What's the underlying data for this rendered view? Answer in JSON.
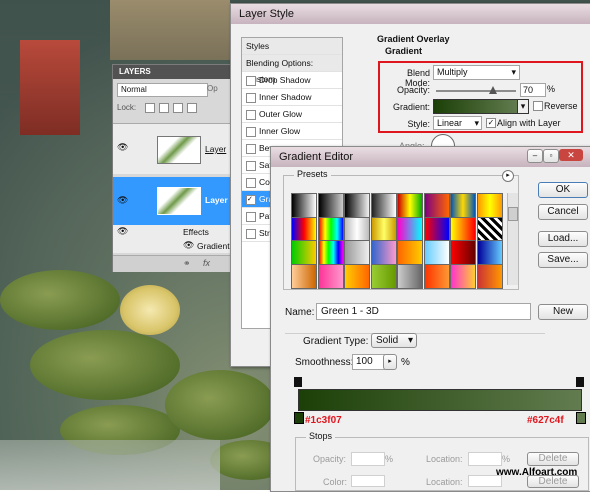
{
  "layers_panel": {
    "title": "LAYERS",
    "blend_mode": "Normal",
    "opacity_label": "Op",
    "lock_label": "Lock:",
    "layer1_name": "Layer",
    "layer2_name": "Layer",
    "effects_label": "Effects",
    "gradient_effect_label": "Gradient",
    "footer_fx": "fx"
  },
  "layer_style": {
    "title": "Layer Style",
    "styles_header": "Styles",
    "blending_options": "Blending Options: Custom",
    "items": [
      "Drop Shadow",
      "Inner Shadow",
      "Outer Glow",
      "Inner Glow",
      "Bev",
      "Sat",
      "Colo",
      "Gra",
      "Patt",
      "Stro"
    ],
    "active_index": 7,
    "section_title": "Gradient Overlay",
    "subsection_title": "Gradient",
    "blend_mode_label": "Blend Mode:",
    "blend_mode_value": "Multiply",
    "opacity_label": "Opacity:",
    "opacity_value": "70",
    "percent": "%",
    "gradient_label": "Gradient:",
    "reverse_label": "Reverse",
    "style_label": "Style:",
    "style_value": "Linear",
    "align_label": "Align with Layer",
    "angle_label": "Angle:"
  },
  "gradient_editor": {
    "title": "Gradient Editor",
    "presets_label": "Presets",
    "ok_label": "OK",
    "cancel_label": "Cancel",
    "load_label": "Load...",
    "save_label": "Save...",
    "name_label": "Name:",
    "name_value": "Green 1 - 3D",
    "new_label": "New",
    "gradient_type_label": "Gradient Type:",
    "gradient_type_value": "Solid",
    "smoothness_label": "Smoothness:",
    "smoothness_value": "100",
    "percent": "%",
    "start_color": "#1c3f07",
    "end_color": "#627c4f",
    "stops_label": "Stops",
    "opacity_label": "Opacity:",
    "location_label": "Location:",
    "color_label": "Color:",
    "delete_label": "Delete"
  },
  "watermark": "www.Alfoart.com",
  "colors": {
    "accent_blue": "#3399ff",
    "annotation_red": "#e0161e",
    "gradient_start": "#1c3f07",
    "gradient_end": "#627c4f"
  }
}
